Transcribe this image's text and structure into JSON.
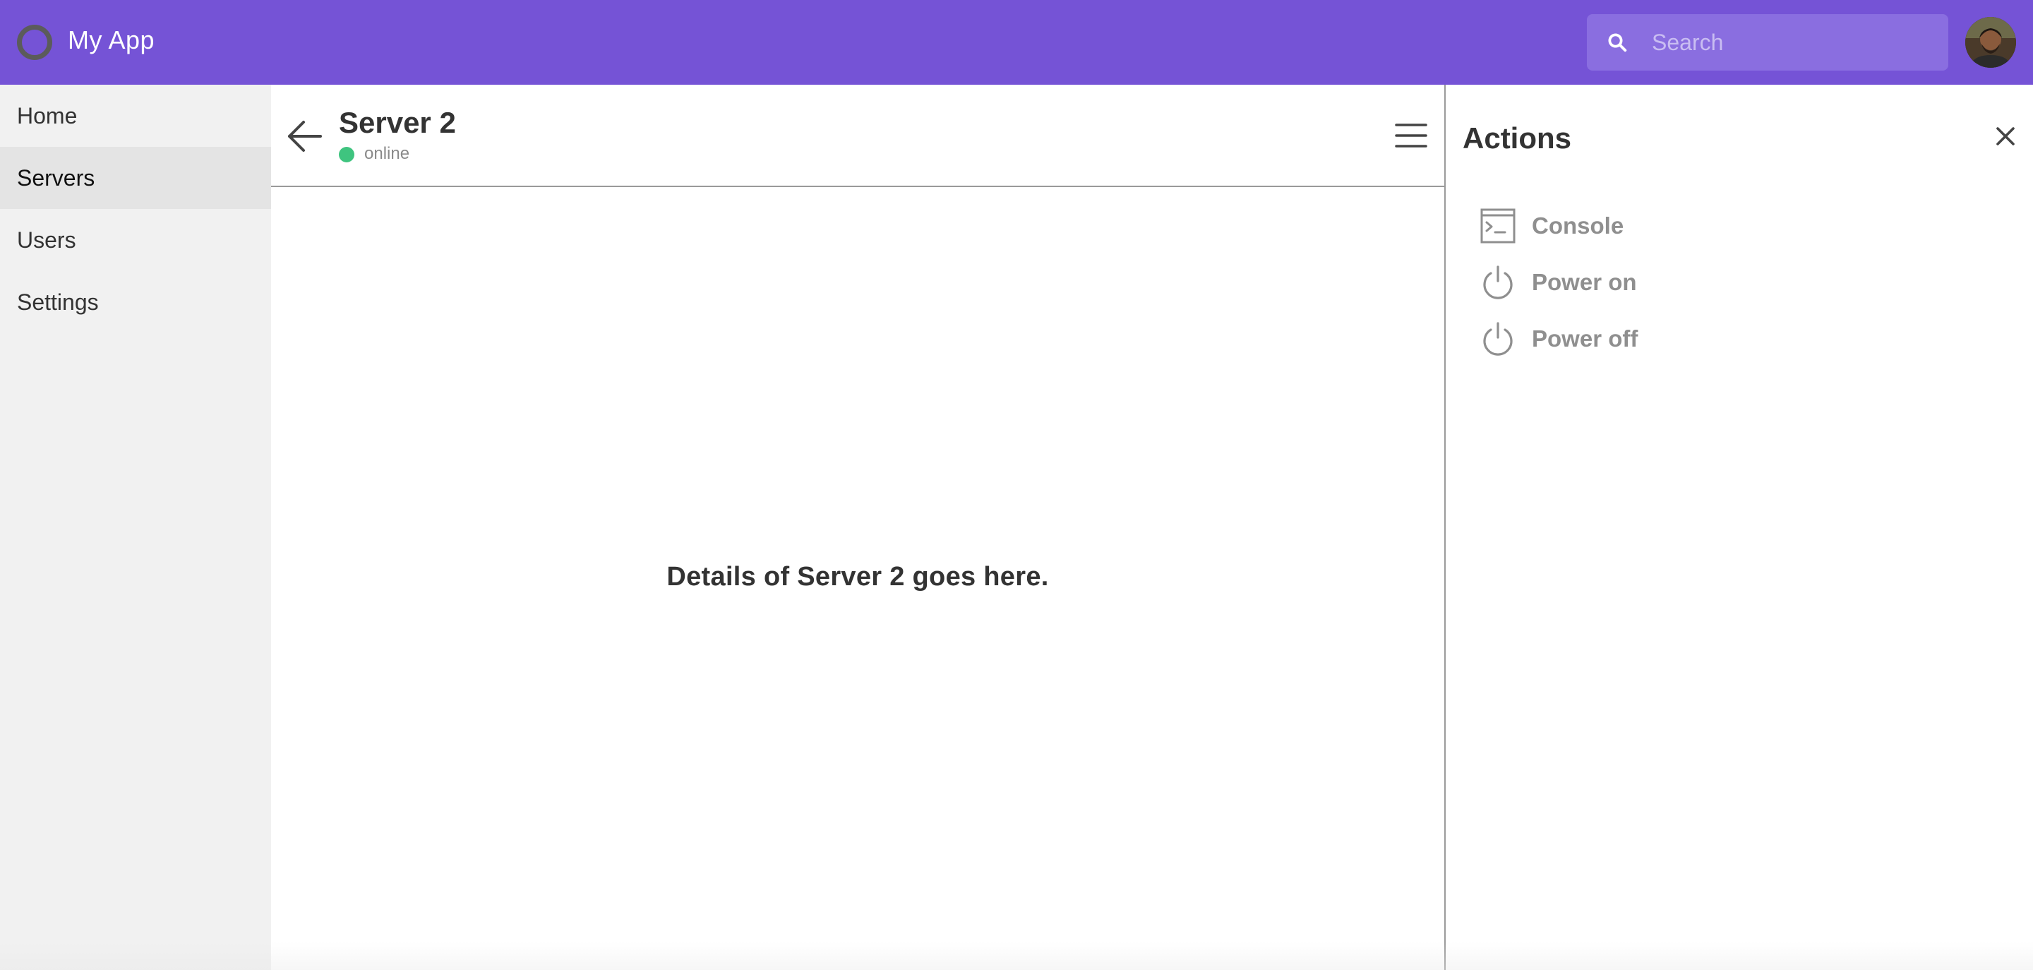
{
  "header": {
    "app_title": "My App",
    "search_placeholder": "Search",
    "accent_color": "#7553d6"
  },
  "sidebar": {
    "items": [
      {
        "label": "Home",
        "active": false
      },
      {
        "label": "Servers",
        "active": true
      },
      {
        "label": "Users",
        "active": false
      },
      {
        "label": "Settings",
        "active": false
      }
    ]
  },
  "main": {
    "title": "Server 2",
    "status": "online",
    "status_color": "#3fc47f",
    "details_text": "Details of Server 2 goes here."
  },
  "actions": {
    "title": "Actions",
    "items": [
      {
        "label": "Console",
        "icon": "terminal-icon"
      },
      {
        "label": "Power on",
        "icon": "power-icon"
      },
      {
        "label": "Power off",
        "icon": "power-icon"
      }
    ]
  }
}
